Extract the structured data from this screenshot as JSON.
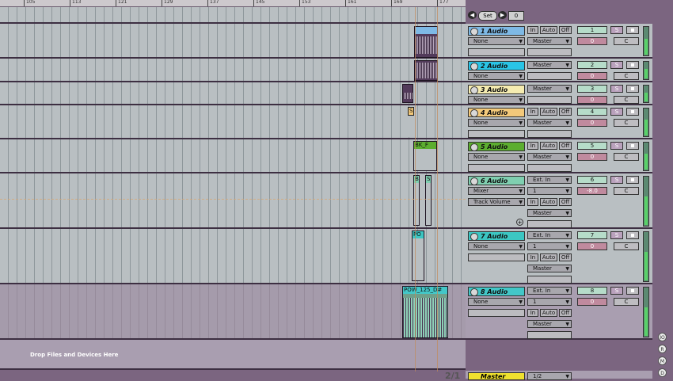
{
  "ruler": {
    "bars": [
      {
        "label": "105",
        "pos": 30
      },
      {
        "label": "113",
        "pos": 88
      },
      {
        "label": "121",
        "pos": 146
      },
      {
        "label": "129",
        "pos": 204
      },
      {
        "label": "137",
        "pos": 262
      },
      {
        "label": "145",
        "pos": 320
      },
      {
        "label": "153",
        "pos": 378
      },
      {
        "label": "161",
        "pos": 436
      },
      {
        "label": "169",
        "pos": 494
      },
      {
        "label": "177",
        "pos": 552
      }
    ]
  },
  "transport": {
    "set_label": "Set",
    "value": "0"
  },
  "clips": {
    "t5": "BK_F",
    "t6a": "B",
    "t6b": "S",
    "t7": "PO",
    "t8": "POW_125_D#",
    "t4": "S"
  },
  "drop_text": "Drop Files and Devices Here",
  "page_indicator": "2/1",
  "tracks": [
    {
      "name": "1 Audio",
      "color": "#7eb9e5",
      "input": "None",
      "output": "Master",
      "num": "1",
      "vol": "0",
      "pan": "C"
    },
    {
      "name": "2 Audio",
      "color": "#29c4e6",
      "input": "None",
      "output": "Master",
      "num": "2",
      "vol": "0",
      "pan": "C"
    },
    {
      "name": "3 Audio",
      "color": "#f5ecb0",
      "input": "None",
      "output": "Master",
      "num": "3",
      "vol": "0",
      "pan": "C"
    },
    {
      "name": "4 Audio",
      "color": "#f3c97a",
      "input": "None",
      "output": "Master",
      "num": "4",
      "vol": "0",
      "pan": "C"
    },
    {
      "name": "5 Audio",
      "color": "#5cae2f",
      "input": "None",
      "output": "Master",
      "num": "5",
      "vol": "0",
      "pan": "C"
    },
    {
      "name": "6 Audio",
      "color": "#7fcfb0",
      "input": "Mixer",
      "input2": "Track Volume",
      "ext": "Ext. In",
      "chan": "1",
      "output": "Master",
      "num": "6",
      "vol": "-8.0",
      "pan": "C"
    },
    {
      "name": "7 Audio",
      "color": "#3cc6c2",
      "input": "None",
      "ext": "Ext. In",
      "chan": "1",
      "output": "Master",
      "num": "7",
      "vol": "0",
      "pan": "C"
    },
    {
      "name": "8 Audio",
      "color": "#43c7c8",
      "input": "None",
      "ext": "Ext. In",
      "chan": "1",
      "output": "Master",
      "num": "8",
      "vol": "0",
      "pan": "C"
    }
  ],
  "master": {
    "name": "Master",
    "color": "#efe12e",
    "value": "1/2"
  },
  "monitor": {
    "in": "In",
    "auto": "Auto",
    "off": "Off"
  },
  "solo_label": "S",
  "side_buttons": [
    "IO",
    "R",
    "M",
    "D"
  ],
  "colors": {
    "lane": "#b9bfc2",
    "border": "#3d2f42",
    "meter": "#59d168",
    "clip": "#523a5a"
  }
}
